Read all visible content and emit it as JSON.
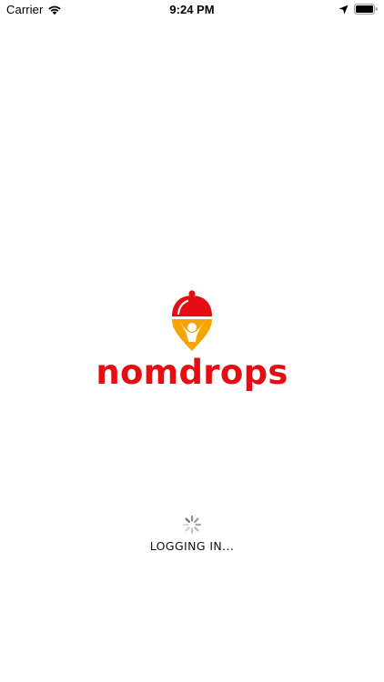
{
  "status_bar": {
    "carrier": "Carrier",
    "time": "9:24 PM",
    "icons": [
      "wifi-icon",
      "location-arrow-icon",
      "battery-icon"
    ]
  },
  "logo": {
    "wordmark": "nomdrops",
    "icon": "cloche-pin-icon",
    "colors": {
      "brand_red": "#e60d12",
      "brand_yellow": "#f5a400"
    }
  },
  "loading": {
    "label": "LOGGING IN...",
    "icon": "spinner-icon"
  }
}
